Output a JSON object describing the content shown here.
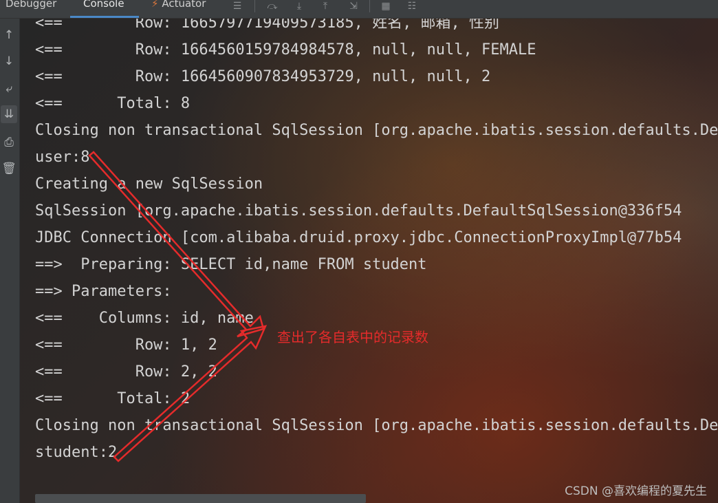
{
  "tabs": [
    {
      "label": "Debugger"
    },
    {
      "label": "Console",
      "active": true
    },
    {
      "label": "Actuator"
    }
  ],
  "console_lines": [
    "<==        Row: 1665797719409573185, 姓名, 邮箱, 性别",
    "<==        Row: 1664560159784984578, null, null, FEMALE",
    "<==        Row: 1664560907834953729, null, null, 2",
    "<==      Total: 8",
    "Closing non transactional SqlSession [org.apache.ibatis.session.defaults.DefaultSqlSession",
    "user:8",
    "Creating a new SqlSession",
    "SqlSession [org.apache.ibatis.session.defaults.DefaultSqlSession@336f54",
    "JDBC Connection [com.alibaba.druid.proxy.jdbc.ConnectionProxyImpl@77b54",
    "==>  Preparing: SELECT id,name FROM student",
    "==> Parameters: ",
    "<==    Columns: id, name",
    "<==        Row: 1, 2",
    "<==        Row: 2, 2",
    "<==      Total: 2",
    "Closing non transactional SqlSession [org.apache.ibatis.session.defaults.DefaultSqlSession",
    "student:2"
  ],
  "annotation": "查出了各自表中的记录数",
  "watermark": "CSDN @喜欢编程的夏先生",
  "colors": {
    "annotation": "#e52b2b",
    "console_text": "#d3d3d3",
    "tab_active_underline": "#4a88c7"
  }
}
